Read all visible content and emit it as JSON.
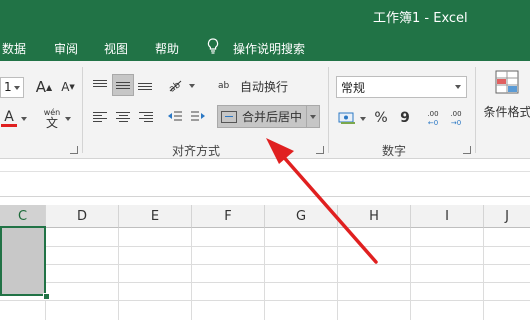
{
  "window": {
    "title": "工作簿1 - Excel"
  },
  "tabs": [
    {
      "label": "数据"
    },
    {
      "label": "审阅"
    },
    {
      "label": "视图"
    },
    {
      "label": "帮助"
    },
    {
      "label": "操作说明搜索",
      "icon": "lightbulb-icon"
    }
  ],
  "ribbon": {
    "font": {
      "size_value": "1",
      "grow_label": "A",
      "shrink_label": "A",
      "font_color_label": "A",
      "phonetic_label": "wén",
      "phonetic_sub": "文"
    },
    "alignment": {
      "wrap_text_label": "自动换行",
      "wrap_icon_label": "ab",
      "merge_center_label": "合并后居中",
      "group_label": "对齐方式"
    },
    "number": {
      "format_value": "常规",
      "percent_label": "%",
      "comma_label": "9",
      "inc_decimal_label": ".00",
      "dec_decimal_label": ".00",
      "group_label": "数字"
    },
    "styles": {
      "conditional_format_label": "条件格式"
    }
  },
  "columns": [
    "C",
    "D",
    "E",
    "F",
    "G",
    "H",
    "I",
    "J"
  ],
  "active_column": "C",
  "annotation": {
    "color": "#e02020",
    "type": "red-arrow"
  },
  "colors": {
    "accent": "#217346",
    "ribbon_bg": "#f3f3f3"
  }
}
